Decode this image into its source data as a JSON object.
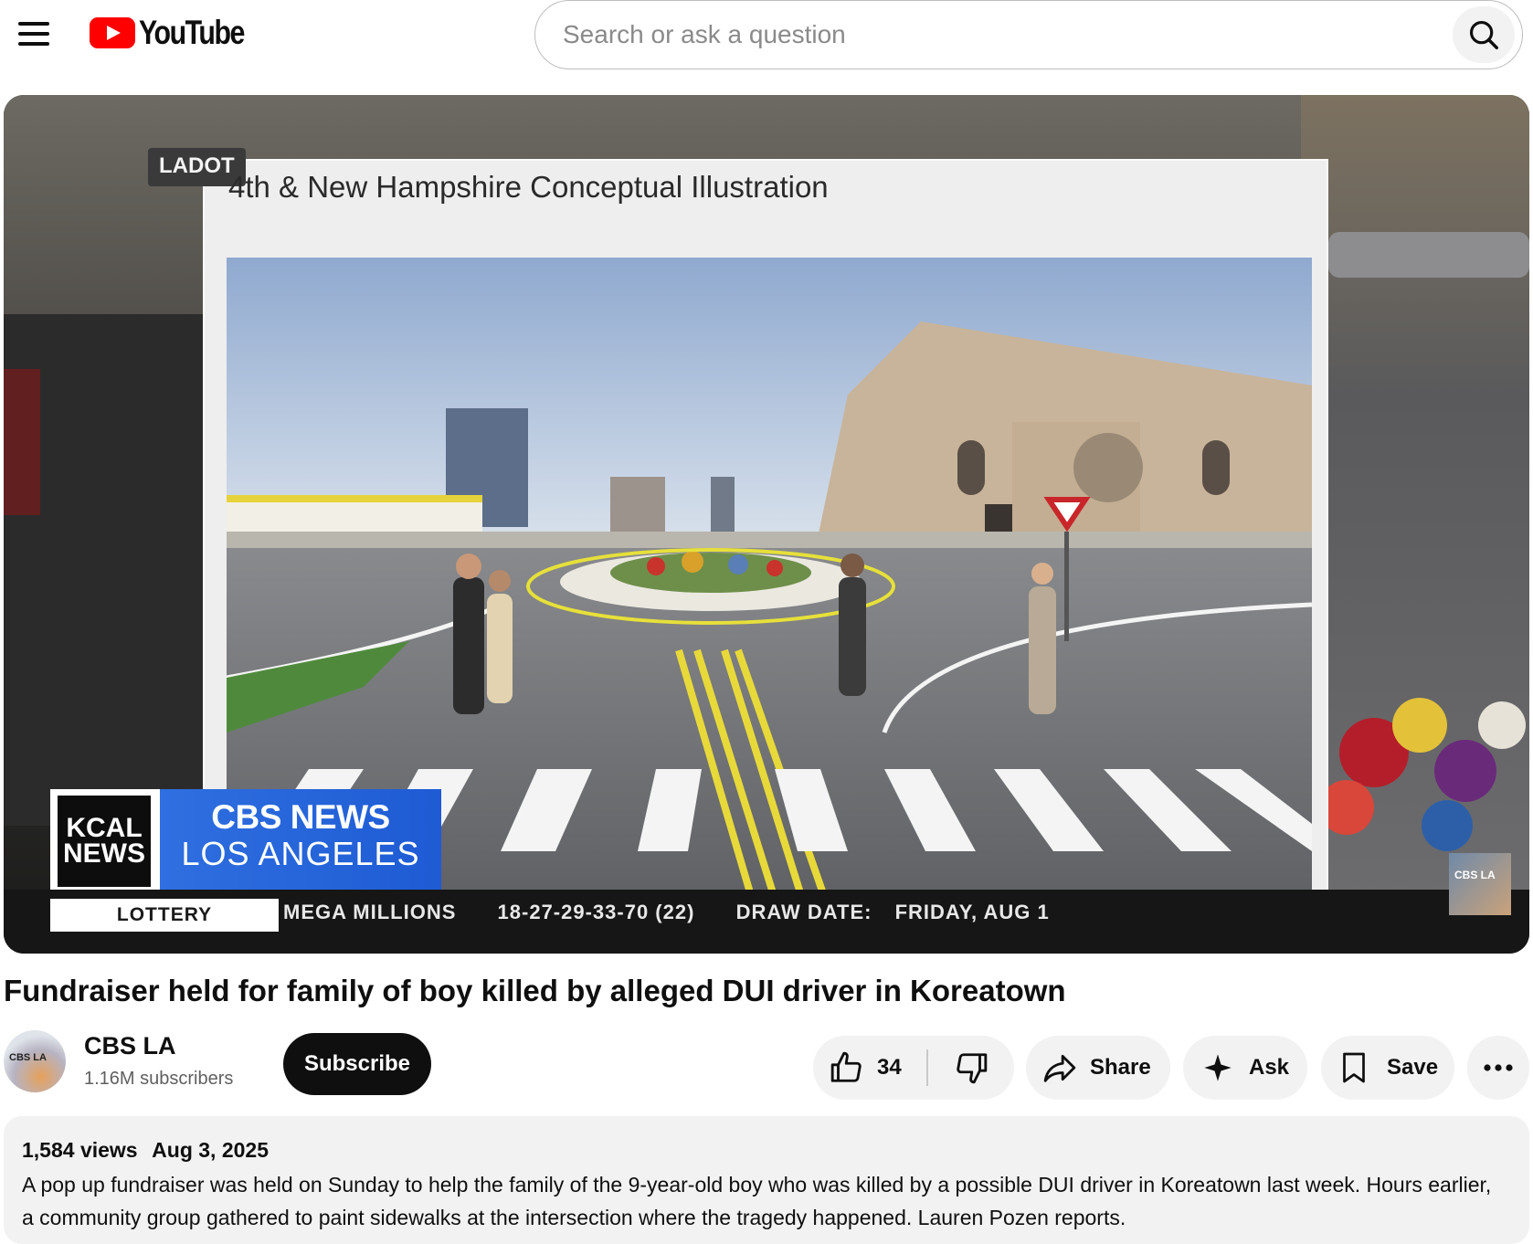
{
  "header": {
    "logo_text": "YouTube",
    "search_placeholder": "Search or ask a question"
  },
  "video": {
    "overlay_tag": "LADOT",
    "card_title": "4th & New Hampshire Conceptual Illustration",
    "station_badge": {
      "kcal_line1": "KCAL",
      "kcal_line2": "NEWS",
      "network": "CBS NEWS",
      "city": "LOS ANGELES"
    },
    "ticker": {
      "label": "LOTTERY",
      "game": "MEGA MILLIONS",
      "numbers": "18-27-29-33-70 (22)",
      "date_label": "DRAW DATE:",
      "date_value": "FRIDAY, AUG 1"
    },
    "corner_bug_text": "CBS LA"
  },
  "title": "Fundraiser held for family of boy killed by alleged DUI driver in Koreatown",
  "channel": {
    "name": "CBS LA",
    "subscribers": "1.16M subscribers",
    "avatar_text": "CBS LA",
    "subscribe_label": "Subscribe"
  },
  "actions": {
    "like_count": "34",
    "share_label": "Share",
    "ask_label": "Ask",
    "save_label": "Save"
  },
  "description": {
    "views": "1,584 views",
    "date": "Aug 3, 2025",
    "text": "A pop up fundraiser was held on Sunday to help the family of the 9-year-old boy who was killed by a possible DUI driver in Koreatown last week. Hours earlier, a community group gathered to paint sidewalks at the intersection where the tragedy happened. Lauren Pozen reports."
  },
  "colors": {
    "brand_red": "#ff0000",
    "cbs_blue": "#1e5bd4",
    "pill_bg": "#f2f2f2"
  }
}
